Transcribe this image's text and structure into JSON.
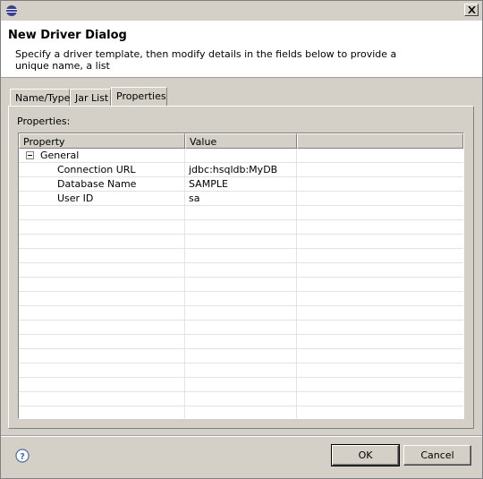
{
  "window": {
    "title": "",
    "close_icon": "close-icon"
  },
  "header": {
    "title": "New Driver Dialog",
    "description": "Specify a driver template, then modify details in the fields below to provide a unique name, a list"
  },
  "tabs": [
    {
      "label": "Name/Type",
      "active": false
    },
    {
      "label": "Jar List",
      "active": false
    },
    {
      "label": "Properties",
      "active": true
    }
  ],
  "properties": {
    "label": "Properties:",
    "columns": [
      "Property",
      "Value",
      ""
    ],
    "group": {
      "name": "General",
      "expanded": true
    },
    "rows": [
      {
        "property": "Connection URL",
        "value": "jdbc:hsqldb:MyDB"
      },
      {
        "property": "Database Name",
        "value": "SAMPLE"
      },
      {
        "property": "User ID",
        "value": "sa"
      }
    ]
  },
  "footer": {
    "help_icon": "help-icon",
    "ok_label": "OK",
    "cancel_label": "Cancel"
  }
}
